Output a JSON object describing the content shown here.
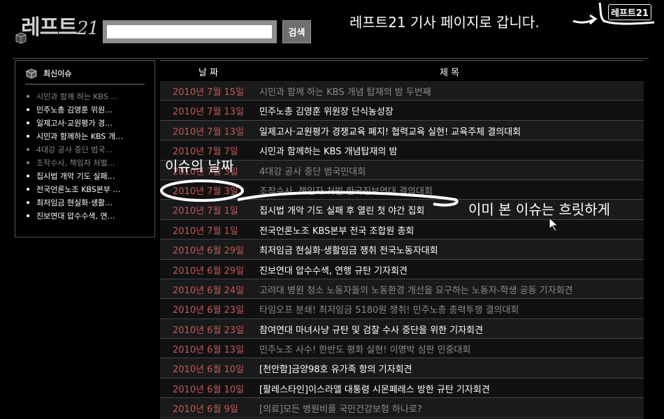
{
  "header": {
    "logo_text": "레프트",
    "logo_num": "21",
    "search": {
      "value": "",
      "placeholder": ""
    },
    "search_button": "검색"
  },
  "annotations": {
    "top_note": "레프트21 기사 페이지로 갑니다.",
    "mini_logo": "레프트21",
    "date_note": "이슈의 날짜",
    "read_note": "이미 본 이슈는 흐릿하게"
  },
  "sidebar": {
    "title": "최신이슈",
    "items": [
      {
        "label": "시민과 함께 하는 KBS …",
        "read": true
      },
      {
        "label": "민주노총 김영훈 위원…",
        "read": false
      },
      {
        "label": "일제고사·교원평가 경…",
        "read": false
      },
      {
        "label": "시민과 함께하는 KBS 개…",
        "read": false
      },
      {
        "label": "4대강 공사 중단 범국…",
        "read": true
      },
      {
        "label": "조작수사, 책임자 처벌…",
        "read": true
      },
      {
        "label": "집시법 개악 기도 실패…",
        "read": false
      },
      {
        "label": "전국언론노조 KBS본부 …",
        "read": false
      },
      {
        "label": "최저임금 현실화·생활…",
        "read": false
      },
      {
        "label": "진보연대 압수수색, 연…",
        "read": false
      }
    ]
  },
  "table": {
    "col_date": "날 짜",
    "col_title": "제 목",
    "rows": [
      {
        "date": "2010년 7월 15일",
        "title": "시민과 함께 하는 KBS 개념 탑재의 밤 두번째",
        "read": true
      },
      {
        "date": "2010년 7월 13일",
        "title": "민주노총 김영훈 위원장 단식농성장",
        "read": false
      },
      {
        "date": "2010년 7월 13일",
        "title": "일제고사·교원평가 경쟁교육 폐지! 협력교육 실현! 교육주체 결의대회",
        "read": false
      },
      {
        "date": "2010년 7월 7일",
        "title": "시민과 함께하는 KBS 개념탑재의 밤",
        "read": false
      },
      {
        "date": "2010년 7월 3일",
        "title": "4대강 공사 중단 범국민대회",
        "read": true
      },
      {
        "date": "2010년 7월 3일",
        "title": "조작수사, 책임자 처벌 한국진보연대 결의대회",
        "read": true
      },
      {
        "date": "2010년 7월 1일",
        "title": "집시법 개악 기도 실패 후 열린 첫 야간 집회",
        "read": false
      },
      {
        "date": "2010년 7월 1일",
        "title": "전국언론노조 KBS본부 전국 조합원 총회",
        "read": false
      },
      {
        "date": "2010년 6월 29일",
        "title": "최저임금 현실화·생활임금 쟁취 전국노동자대회",
        "read": false
      },
      {
        "date": "2010년 6월 29일",
        "title": "진보연대 압수수색, 연행 규탄 기자회견",
        "read": false
      },
      {
        "date": "2010년 6월 24일",
        "title": "고려대 병원 청소 노동자들의 노동환경 개선을 요구하는 노동자-학생 공동 기자회견",
        "read": true
      },
      {
        "date": "2010년 6월 23일",
        "title": "타임오프 분쇄! 최저임금 5180원 쟁취! 민주노총 총력투쟁 결의대회",
        "read": true
      },
      {
        "date": "2010년 6월 23일",
        "title": "참여연대 마녀사냥 규탄 및 검찰 수사 중단을 위한 기자회견",
        "read": false
      },
      {
        "date": "2010년 6월 13일",
        "title": "민주노조 사수! 한반도 평화 실현! 이명박 심판 민중대회",
        "read": true
      },
      {
        "date": "2010년 6월 10일",
        "title": "[천안함]금양98호 유가족 항의 기자회견",
        "read": false
      },
      {
        "date": "2010년 6월 10일",
        "title": "[팔레스타인]이스라엘 대통령 시몬페레스 방한 규탄 기자회견",
        "read": false
      },
      {
        "date": "2010년 6월 9일",
        "title": "[의료]모든 병원비를 국민건강보험 하나로?",
        "read": true
      }
    ]
  }
}
